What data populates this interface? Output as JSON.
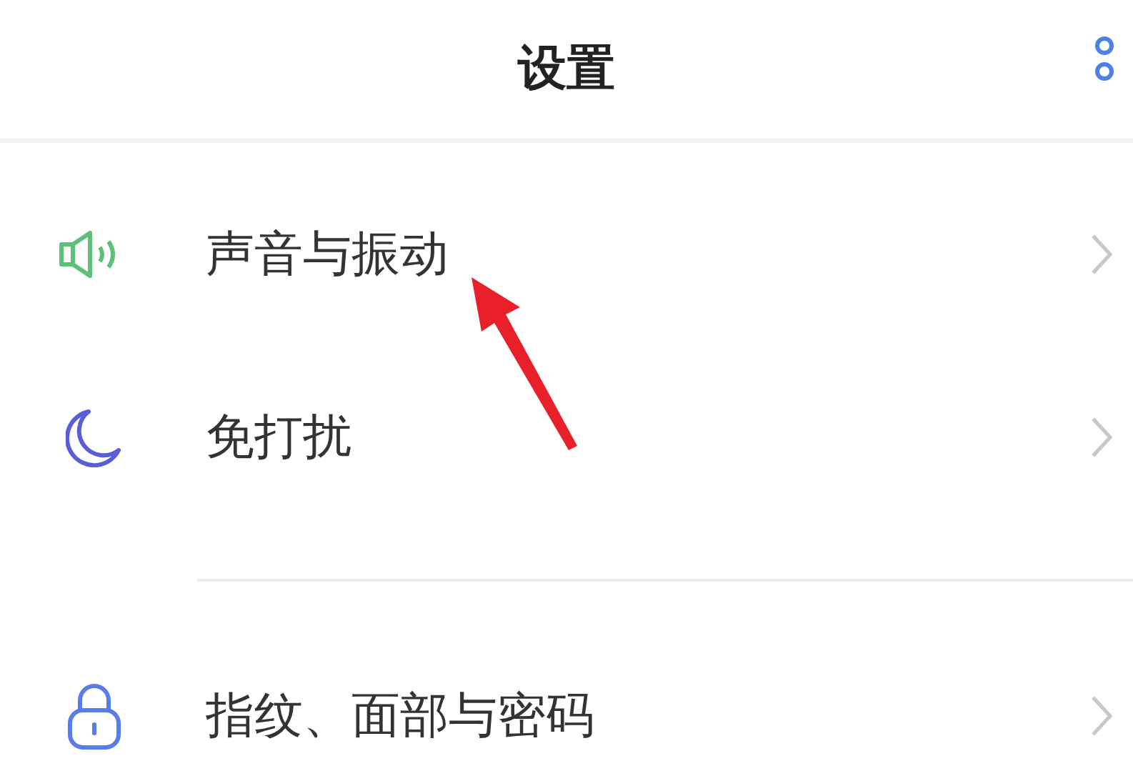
{
  "header": {
    "title": "设置"
  },
  "groups": [
    {
      "items": [
        {
          "label": "声音与振动"
        },
        {
          "label": "免打扰"
        }
      ]
    },
    {
      "items": [
        {
          "label": "指纹、面部与密码"
        }
      ]
    }
  ]
}
